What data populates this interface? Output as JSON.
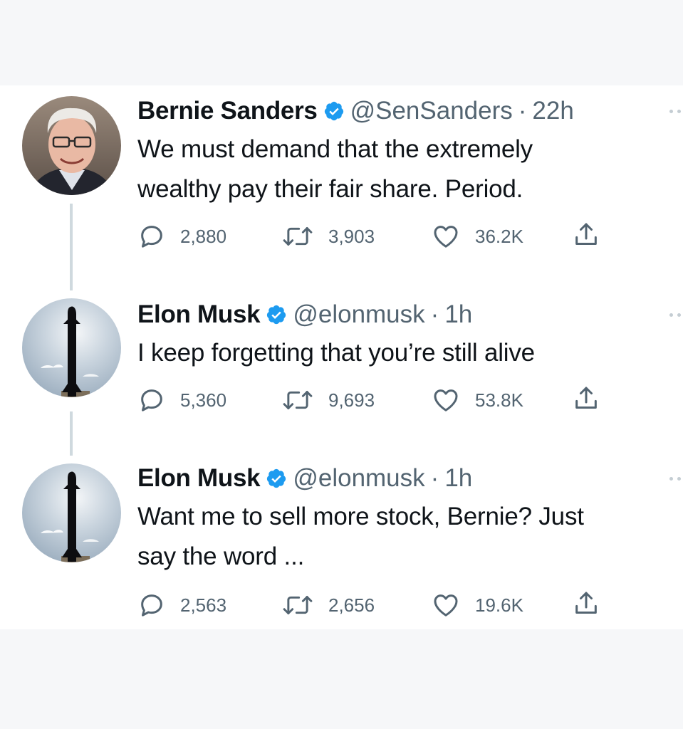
{
  "tweets": [
    {
      "author": "Bernie Sanders",
      "handle": "@SenSanders",
      "separator": "·",
      "time": "22h",
      "lines": [
        "We must demand that the extremely",
        "wealthy pay their fair share. Period."
      ],
      "replies": "2,880",
      "retweets": "3,903",
      "likes": "36.2K",
      "verified": true
    },
    {
      "author": "Elon Musk",
      "handle": "@elonmusk",
      "separator": "·",
      "time": "1h",
      "lines": [
        "I keep forgetting that you’re still alive"
      ],
      "replies": "5,360",
      "retweets": "9,693",
      "likes": "53.8K",
      "verified": true
    },
    {
      "author": "Elon Musk",
      "handle": "@elonmusk",
      "separator": "·",
      "time": "1h",
      "lines": [
        "Want me to sell more stock, Bernie? Just",
        "say the word ..."
      ],
      "replies": "2,563",
      "retweets": "2,656",
      "likes": "19.6K",
      "verified": true
    }
  ],
  "icons": {
    "reply": "reply-icon",
    "retweet": "retweet-icon",
    "like": "heart-icon",
    "share": "share-icon",
    "verified": "verified-badge-icon",
    "more": "more-icon"
  },
  "colors": {
    "verified": "#1d9bf0",
    "secondary_text": "#536471",
    "primary_text": "#0f1419",
    "thread_line": "#cfd9de",
    "page_background": "#f6f7f9"
  }
}
